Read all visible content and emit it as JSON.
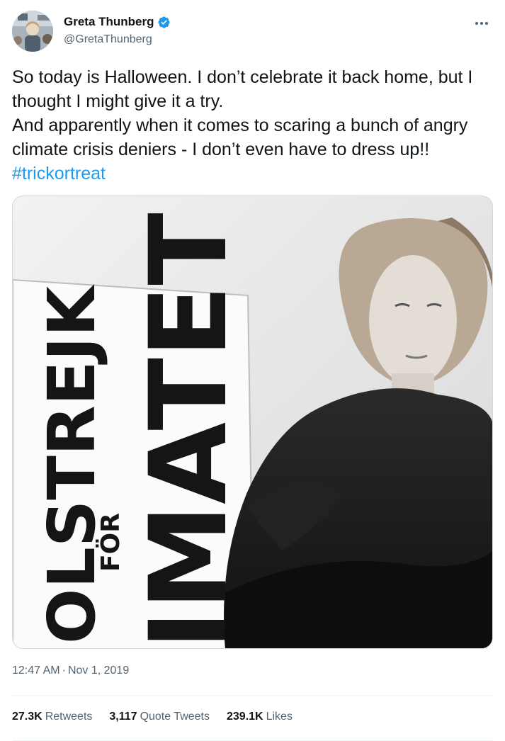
{
  "author": {
    "name": "Greta Thunberg",
    "handle": "@GretaThunberg",
    "verified": true
  },
  "tweet": {
    "line1": "So today is Halloween. I don’t celebrate it back home, but I thought I might give it a try.",
    "line2": "And apparently when it comes to scaring a bunch of angry climate crisis deniers - I don’t even have to dress up!! ",
    "hashtag": "#trickortreat"
  },
  "media": {
    "sign_text_top": "OLSTREJK",
    "sign_text_mid": "FÖR",
    "sign_text_bottom": "IMATET"
  },
  "meta": {
    "time": "12:47 AM",
    "separator": "·",
    "date": "Nov 1, 2019"
  },
  "stats": {
    "retweets_count": "27.3K",
    "retweets_label": "Retweets",
    "quotes_count": "3,117",
    "quotes_label": "Quote Tweets",
    "likes_count": "239.1K",
    "likes_label": "Likes"
  },
  "colors": {
    "accent": "#1d9bf0",
    "text": "#0f1419",
    "secondary": "#536471"
  }
}
